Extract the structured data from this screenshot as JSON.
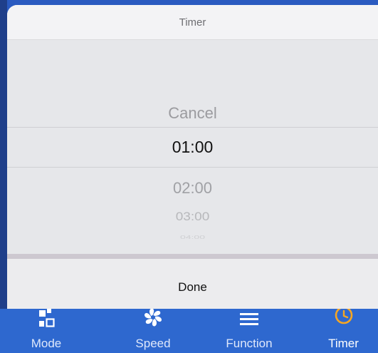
{
  "sheet": {
    "title": "Timer"
  },
  "picker": {
    "cancel": "Cancel",
    "selected": "01:00",
    "options": [
      "02:00",
      "03:00",
      "04:00"
    ]
  },
  "actions": {
    "done": "Done"
  },
  "tabbar": {
    "items": [
      {
        "label": "Mode",
        "icon": "mode-icon"
      },
      {
        "label": "Speed",
        "icon": "fan-icon"
      },
      {
        "label": "Function",
        "icon": "menu-icon"
      },
      {
        "label": "Timer",
        "icon": "clock-icon"
      }
    ],
    "active": "Timer"
  },
  "colors": {
    "tabbar": "#2e68cf",
    "accent": "#f5a623",
    "sheet": "#e9eaec"
  }
}
